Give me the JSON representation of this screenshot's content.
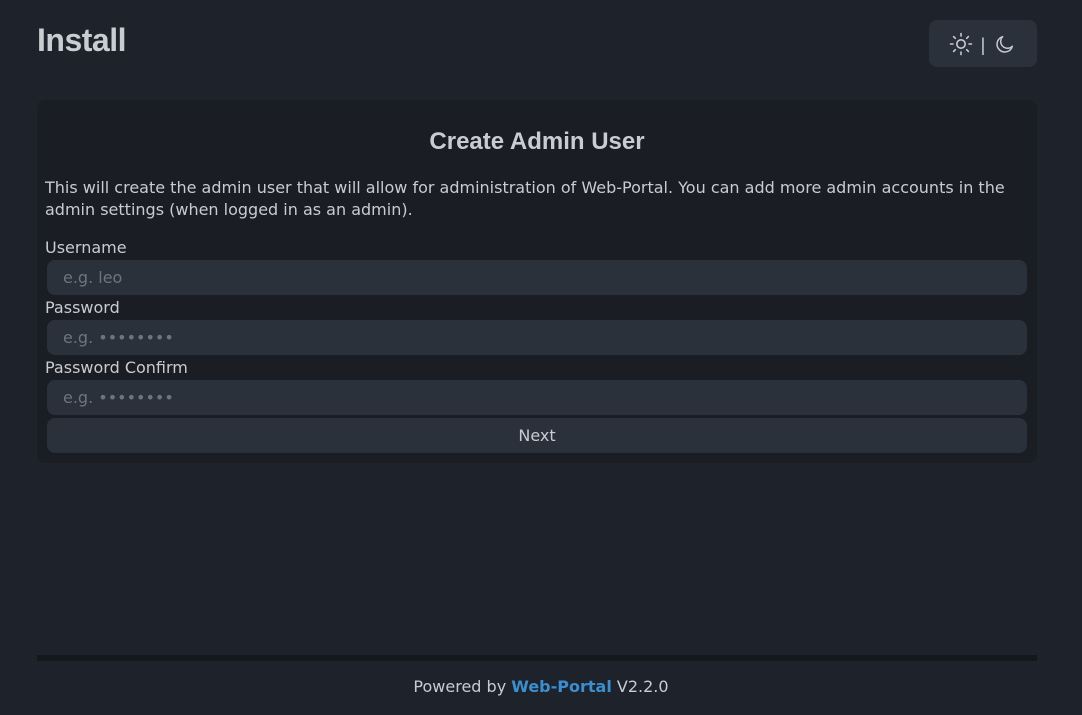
{
  "header": {
    "title": "Install",
    "theme_toggle": {
      "light_icon": "sun-icon",
      "separator": "|",
      "dark_icon": "moon-icon"
    }
  },
  "card": {
    "title": "Create Admin User",
    "description": "This will create the admin user that will allow for administration of Web-Portal. You can add more admin accounts in the admin settings (when logged in as an admin).",
    "fields": [
      {
        "label": "Username",
        "placeholder": "e.g. leo",
        "value": ""
      },
      {
        "label": "Password",
        "placeholder": "e.g. ••••••••",
        "value": ""
      },
      {
        "label": "Password Confirm",
        "placeholder": "e.g. ••••••••",
        "value": ""
      }
    ],
    "next_label": "Next"
  },
  "footer": {
    "prefix": "Powered by",
    "brand": "Web-Portal",
    "version": "V2.2.0"
  },
  "colors": {
    "background": "#1e222a",
    "card": "#1a1d24",
    "input": "#2b313b",
    "text": "#c8ccd2",
    "accent": "#3a8fd0"
  }
}
